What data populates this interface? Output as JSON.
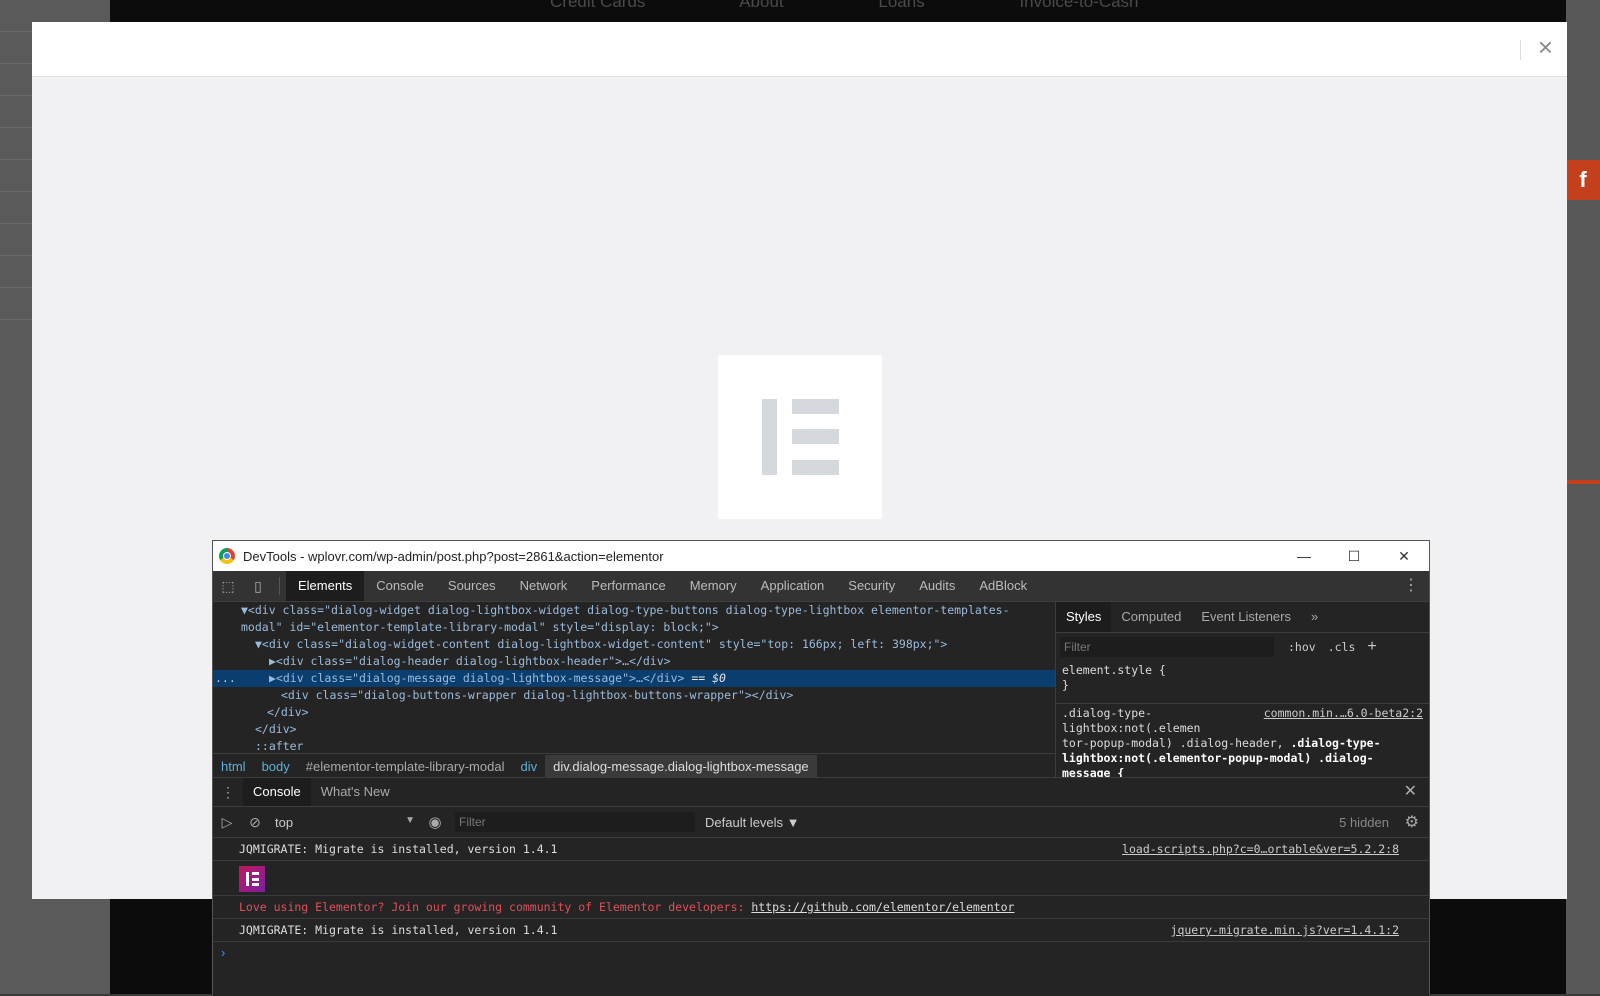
{
  "background_page": {
    "nav": [
      "Credit Cards",
      "About",
      "Loans",
      "Invoice-to-Cash"
    ],
    "social_icon": "f"
  },
  "modal": {
    "close_icon": "×",
    "loader_logo": "elementor-logo"
  },
  "devtools": {
    "window_title": "DevTools - wplovr.com/wp-admin/post.php?post=2861&action=elementor",
    "win_buttons": [
      "—",
      "☐",
      "✕"
    ],
    "tabs": [
      "Elements",
      "Console",
      "Sources",
      "Network",
      "Performance",
      "Memory",
      "Application",
      "Security",
      "Audits",
      "AdBlock"
    ],
    "active_tab": "Elements",
    "dom": {
      "l0a": "▼<div class=\"dialog-widget dialog-lightbox-widget dialog-type-buttons dialog-type-lightbox elementor-templates-",
      "l0b": "modal\" id=\"elementor-template-library-modal\" style=\"display: block;\">",
      "l1": "▼<div class=\"dialog-widget-content dialog-lightbox-widget-content\" style=\"top: 166px; left: 398px;\">",
      "l2": "▶<div class=\"dialog-header dialog-lightbox-header\">…</div>",
      "l3": "▶<div class=\"dialog-message dialog-lightbox-message\">…</div>",
      "l3eq": "== $0",
      "l4": "<div class=\"dialog-buttons-wrapper dialog-lightbox-buttons-wrapper\"></div>",
      "l5": "</div>",
      "l6": "</div>",
      "l7": "::after",
      "dots": "..."
    },
    "breadcrumb": [
      "html",
      "body",
      "#elementor-template-library-modal",
      "div",
      "div.dialog-message.dialog-lightbox-message"
    ],
    "styles": {
      "tabs": [
        "Styles",
        "Computed",
        "Event Listeners"
      ],
      "more": "»",
      "filter_placeholder": "Filter",
      "hov": ":hov",
      "cls": ".cls",
      "plus": "+",
      "rule1_sel": "element.style {",
      "rule1_close": "}",
      "rule2_src": "common.min.…6.0-beta2:2",
      "rule2_sel_a": ".dialog-type-",
      "rule2_sel_b": "lightbox:not(.elemen",
      "rule2_sel_c": "tor-popup-modal) .dialog-header,",
      "rule2_sel_d": ".dialog-type-",
      "rule2_sel_e": "lightbox:not(.elementor-popup-modal) .dialog-",
      "rule2_sel_f": "message {"
    },
    "drawer": {
      "tabs": [
        "Console",
        "What's New"
      ],
      "context": "top",
      "filter_placeholder": "Filter",
      "levels": "Default levels ▼",
      "hidden": "5 hidden",
      "messages": {
        "m1_text": "JQMIGRATE: Migrate is installed, version 1.4.1",
        "m1_src": "load-scripts.php?c=0…ortable&ver=5.2.2:8",
        "m2_text": "Love using Elementor? Join our growing community of Elementor developers: ",
        "m2_link": "https://github.com/elementor/elementor",
        "m3_text": "JQMIGRATE: Migrate is installed, version 1.4.1",
        "m3_src": "jquery-migrate.min.js?ver=1.4.1:2"
      },
      "prompt": "›"
    }
  },
  "colors": {
    "accent_selected": "#093e6e",
    "elementor_logo": "#c2185b",
    "console_error": "#e0505a"
  }
}
